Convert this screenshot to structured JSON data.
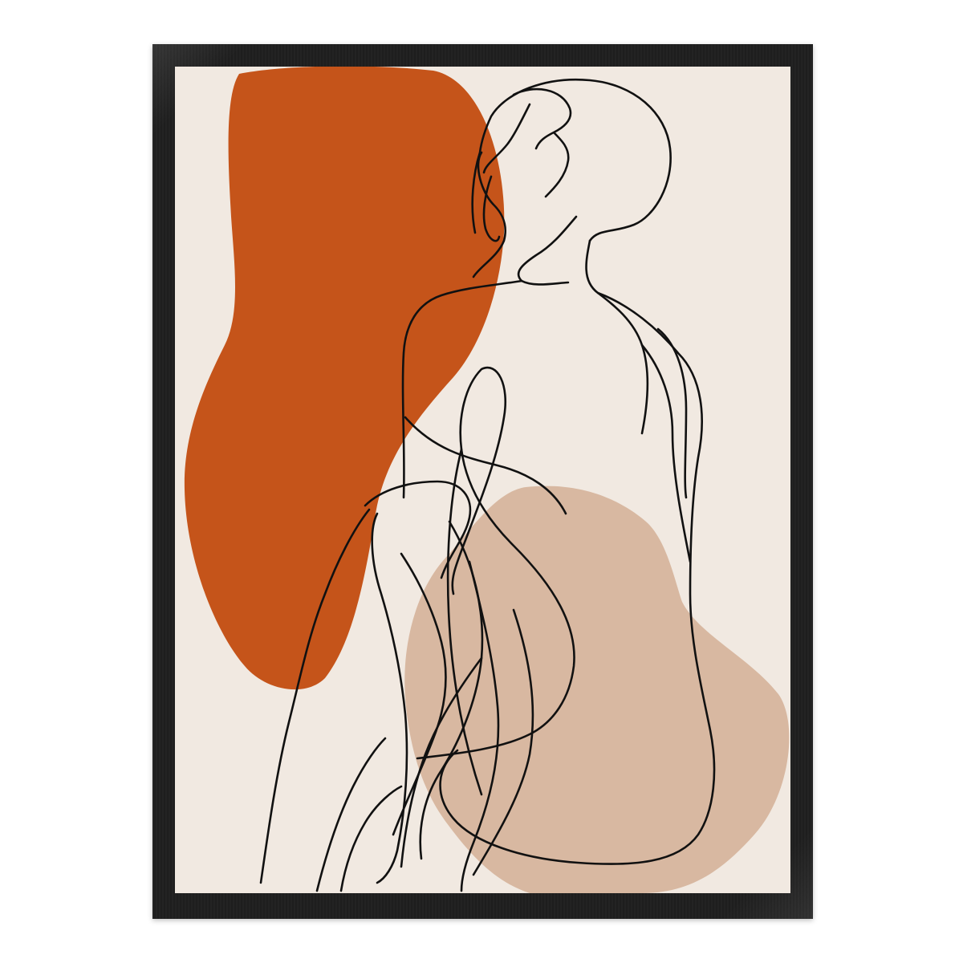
{
  "artwork": {
    "colors": {
      "frame": "#1f1f1f",
      "paper": "#f1e9e1",
      "terracotta": "#c5541a",
      "beige": "#d8b8a1",
      "line": "#111111"
    },
    "icons": [
      "seated-figure-line-art"
    ]
  }
}
